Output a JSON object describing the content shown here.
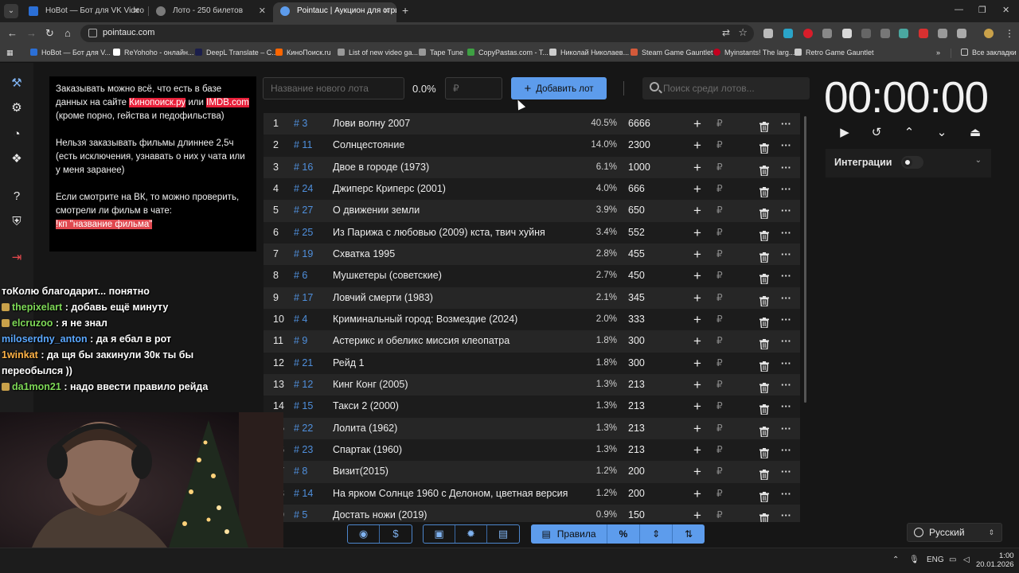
{
  "browser": {
    "tabs": [
      {
        "title": "HoBot — Бот для VK Video Live",
        "favicon_color": "#2b6fd6"
      },
      {
        "title": "Лото - 250 билетов",
        "favicon_color": "#7a7a7a"
      },
      {
        "title": "Pointauc | Аукцион для стримеров",
        "favicon_color": "#5d9cec",
        "active": true
      }
    ],
    "url": "pointauc.com",
    "bookmarks": [
      {
        "label": "HoBot — Бот для V...",
        "color": "#2b6fd6"
      },
      {
        "label": "ReYohoho - онлайн...",
        "color": "#ffffff"
      },
      {
        "label": "DeepL Translate – C...",
        "color": "#1b1e4b"
      },
      {
        "label": "КиноПоиск.ru",
        "color": "#ff6600"
      },
      {
        "label": "List of new video ga...",
        "color": "#999999"
      },
      {
        "label": "Tape Tune",
        "color": "#999999"
      },
      {
        "label": "CopyPastas.com - T...",
        "color": "#3ea043"
      },
      {
        "label": "Николай Николаев...",
        "color": "#cccccc"
      },
      {
        "label": "Steam Game Gauntlet",
        "color": "#d45a3a"
      },
      {
        "label": "Myinstants! The larg...",
        "color": "#c4001f"
      },
      {
        "label": "Retro Game Gauntlet",
        "color": "#cccccc"
      }
    ],
    "all_bookmarks_label": "Все закладки"
  },
  "rules_panel": {
    "p1_before": "Заказывать можно всё, что есть в базе данных на сайте ",
    "p1_link1": "Кинопоиск.ру",
    "p1_mid": " или ",
    "p1_link2": "IMDB.com",
    "p1_after": " (кроме порно, гейства и педофильства)",
    "p2": "Нельзя заказывать фильмы длиннее 2,5ч (есть исключения, узнавать о них у чата или у меня заранее)",
    "p3": "Если смотрите на ВК, то можно проверить, смотрели ли фильм в чате:",
    "p3_command": "!кп \"название фильма\""
  },
  "controls": {
    "lot_name_placeholder": "Название нового лота",
    "percent": "0.0%",
    "amount_placeholder": "₽",
    "add_button": "Добавить лот",
    "search_placeholder": "Поиск среди лотов..."
  },
  "lots": [
    {
      "n": "1",
      "id": "# 3",
      "name": "Лови волну 2007",
      "pct": "40.5%",
      "amount": "6666"
    },
    {
      "n": "2",
      "id": "# 11",
      "name": "Солнцестояние",
      "pct": "14.0%",
      "amount": "2300"
    },
    {
      "n": "3",
      "id": "# 16",
      "name": "Двое в городе (1973)",
      "pct": "6.1%",
      "amount": "1000"
    },
    {
      "n": "4",
      "id": "# 24",
      "name": "Джиперс Криперс (2001)",
      "pct": "4.0%",
      "amount": "666"
    },
    {
      "n": "5",
      "id": "# 27",
      "name": "О движении земли",
      "pct": "3.9%",
      "amount": "650"
    },
    {
      "n": "6",
      "id": "# 25",
      "name": "Из Парижа с любовью (2009) кста, твич хуйня",
      "pct": "3.4%",
      "amount": "552"
    },
    {
      "n": "7",
      "id": "# 19",
      "name": "Схватка 1995",
      "pct": "2.8%",
      "amount": "455"
    },
    {
      "n": "8",
      "id": "# 6",
      "name": "Мушкетеры (советские)",
      "pct": "2.7%",
      "amount": "450"
    },
    {
      "n": "9",
      "id": "# 17",
      "name": "Ловчий смерти (1983)",
      "pct": "2.1%",
      "amount": "345"
    },
    {
      "n": "10",
      "id": "# 4",
      "name": "Криминальный город: Возмездие (2024)",
      "pct": "2.0%",
      "amount": "333"
    },
    {
      "n": "11",
      "id": "# 9",
      "name": "Астерикс и обеликс миссия клеопатра",
      "pct": "1.8%",
      "amount": "300"
    },
    {
      "n": "12",
      "id": "# 21",
      "name": "Рейд 1",
      "pct": "1.8%",
      "amount": "300"
    },
    {
      "n": "13",
      "id": "# 12",
      "name": "Кинг Конг (2005)",
      "pct": "1.3%",
      "amount": "213"
    },
    {
      "n": "14",
      "id": "# 15",
      "name": "Такси 2 (2000)",
      "pct": "1.3%",
      "amount": "213"
    },
    {
      "n": "15",
      "id": "# 22",
      "name": "Лолита (1962)",
      "pct": "1.3%",
      "amount": "213"
    },
    {
      "n": "16",
      "id": "# 23",
      "name": "Спартак (1960)",
      "pct": "1.3%",
      "amount": "213"
    },
    {
      "n": "17",
      "id": "# 8",
      "name": "Визит(2015)",
      "pct": "1.2%",
      "amount": "200"
    },
    {
      "n": "18",
      "id": "# 14",
      "name": "На ярком Солнце 1960 с Делоном, цветная версия",
      "pct": "1.2%",
      "amount": "200"
    },
    {
      "n": "19",
      "id": "# 5",
      "name": "Достать ножи (2019)",
      "pct": "0.9%",
      "amount": "150"
    }
  ],
  "lot_row_labels": {
    "add": "+",
    "currency": "₽",
    "more": "···"
  },
  "timer": {
    "display": "00:00:00"
  },
  "integrations": {
    "label": "Интеграции"
  },
  "bottom_toolbar": {
    "rules_label": "Правила",
    "percent_label": "%"
  },
  "language": {
    "selected": "Русский"
  },
  "chat": [
    {
      "user": "",
      "text": "тоКолю благодарит... понятно"
    },
    {
      "user": "thepixelart",
      "text": ": добавь ещё минуту"
    },
    {
      "user": "elcruzoo",
      "text": ": я не знал"
    },
    {
      "user": "miloserdny_anton",
      "text": ": да я ебал в рот"
    },
    {
      "user": "1winkat",
      "text": ": да щя бы закинули 30к ты бы переобылся ))"
    },
    {
      "user": "da1mon21",
      "text": ": надо ввести правило рейда"
    }
  ],
  "taskbar": {
    "lang": "ENG",
    "time": "1:00",
    "date": "20.01.2026"
  }
}
